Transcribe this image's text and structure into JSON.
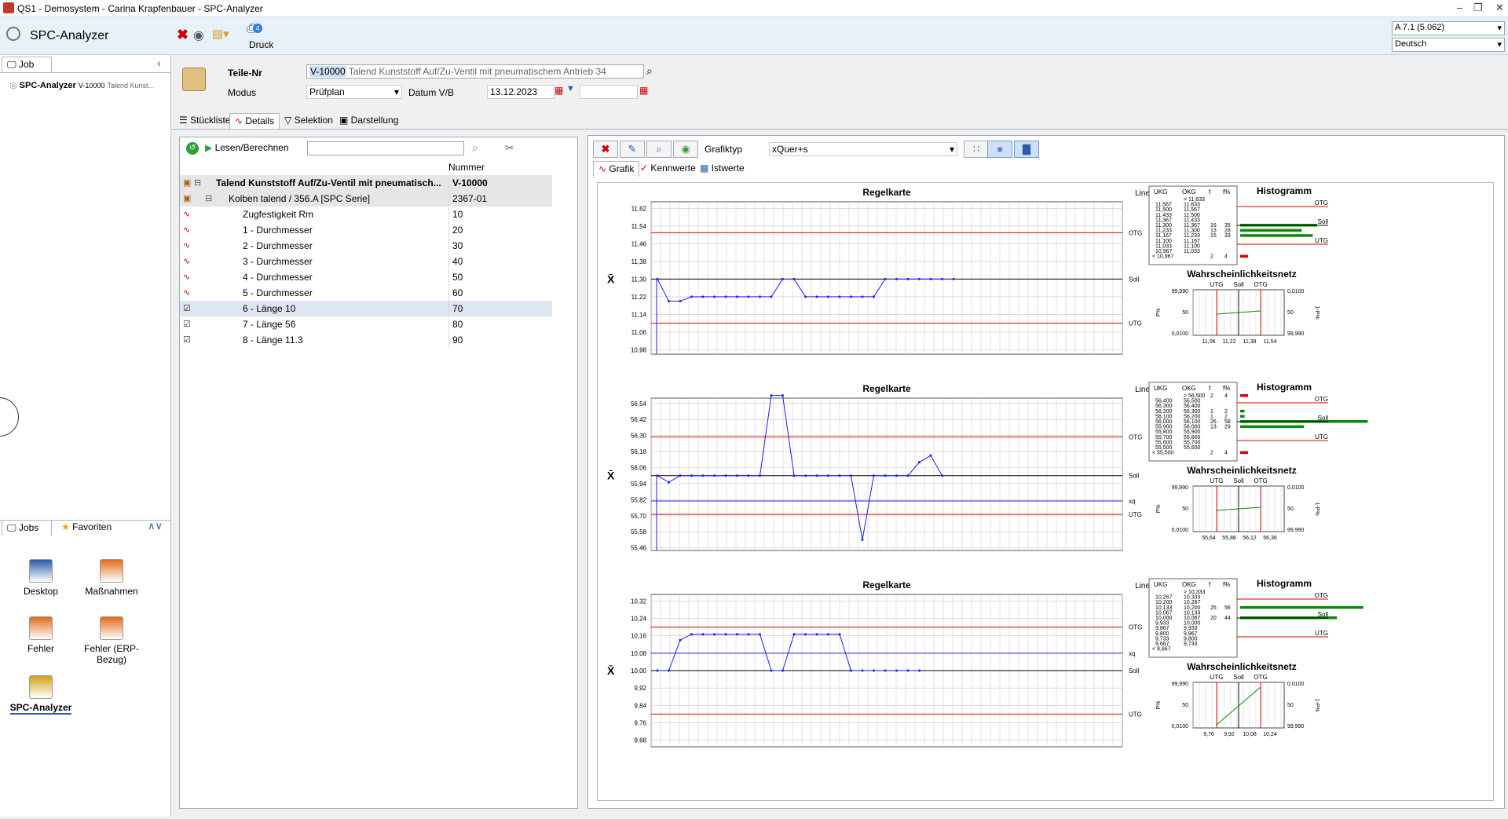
{
  "window": {
    "title": "QS1 - Demosystem - Carina Krapfenbauer - SPC-Analyzer"
  },
  "ribbon": {
    "app": "SPC-Analyzer",
    "print": "Druck",
    "print_badge": "4",
    "version": "A 7.1 (5.062)",
    "language": "Deutsch"
  },
  "left": {
    "job_tab": "Job",
    "job_title": "SPC-Analyzer",
    "job_part": "V-10000",
    "job_desc": "Talend Kunst...",
    "jobs_tab": "Jobs",
    "fav_tab": "Favoriten",
    "apps": [
      {
        "label": "Desktop"
      },
      {
        "label": "Maßnahmen"
      },
      {
        "label": "Fehler"
      },
      {
        "label": "Fehler (ERP-Bezug)"
      },
      {
        "label": "SPC-Analyzer"
      }
    ]
  },
  "form": {
    "part_label": "Teile-Nr",
    "part_id": "V-10000",
    "part_desc": "Talend Kunststoff Auf/Zu-Ventil mit pneumatischem Antrieb  34",
    "mode_label": "Modus",
    "mode_value": "Prüfplan",
    "date_label": "Datum V/B",
    "date_from": "13.12.2023",
    "date_to": ""
  },
  "tabs": {
    "t1": "Stückliste",
    "t2": "Details",
    "t3": "Selektion",
    "t4": "Darstellung"
  },
  "tree": {
    "read_button": "Lesen/Berechnen",
    "col_number": "Nummer",
    "rows": [
      {
        "label": "Talend Kunststoff Auf/Zu-Ventil mit pneumatisch...",
        "number": "V-10000",
        "level": 0,
        "bold": true
      },
      {
        "label": "Kolben talend / 356.A   [SPC Serie]",
        "number": "2367-01",
        "level": 1,
        "bold": false
      },
      {
        "label": "Zugfestigkeit Rm",
        "number": "10",
        "level": 2,
        "bold": false
      },
      {
        "label": "1 - Durchmesser",
        "number": "20",
        "level": 2,
        "bold": false
      },
      {
        "label": "2 - Durchmesser",
        "number": "30",
        "level": 2,
        "bold": false
      },
      {
        "label": "3 - Durchmesser",
        "number": "40",
        "level": 2,
        "bold": false
      },
      {
        "label": "4 - Durchmesser",
        "number": "50",
        "level": 2,
        "bold": false
      },
      {
        "label": "5 - Durchmesser",
        "number": "60",
        "level": 2,
        "bold": false
      },
      {
        "label": "6 - Länge 10",
        "number": "70",
        "level": 2,
        "bold": false
      },
      {
        "label": "7 - Länge 56",
        "number": "80",
        "level": 2,
        "bold": false
      },
      {
        "label": "8 - Länge 11.3",
        "number": "90",
        "level": 2,
        "bold": false
      }
    ]
  },
  "graph": {
    "type_label": "Grafiktyp",
    "type_value": "xQuer+s",
    "tab_grafik": "Grafik",
    "tab_kenn": "Kennwerte",
    "tab_ist": "Istwerte"
  },
  "chart_data": [
    {
      "type": "line",
      "title": "Regelkarte",
      "scale": "Linear",
      "symbol": "X̄",
      "yticks": [
        "11,62",
        "11,54",
        "11,46",
        "11,38",
        "11,30",
        "11,22",
        "11,14",
        "11,06",
        "10,98"
      ],
      "ylim": [
        10.96,
        11.65
      ],
      "lines": [
        {
          "label": "OTG",
          "y": 11.51,
          "color": "#e00000"
        },
        {
          "label": "Soll",
          "y": 11.3,
          "color": "#000000"
        },
        {
          "label": "UTG",
          "y": 11.1,
          "color": "#e00000"
        }
      ],
      "values": [
        11.3,
        11.2,
        11.2,
        11.22,
        11.22,
        11.22,
        11.22,
        11.22,
        11.22,
        11.22,
        11.22,
        11.3,
        11.3,
        11.22,
        11.22,
        11.22,
        11.22,
        11.22,
        11.22,
        11.22,
        11.3,
        11.3,
        11.3,
        11.3,
        11.3,
        11.3,
        11.3
      ],
      "hist": {
        "title": "Histogramm",
        "cols": [
          "UKG",
          "OKG",
          "f",
          "f%"
        ],
        "rows": [
          [
            "",
            "> 11,633",
            "",
            ""
          ],
          [
            "11,567",
            "11,633",
            "",
            ""
          ],
          [
            "11,500",
            "11,567",
            "",
            ""
          ],
          [
            "11,433",
            "11,500",
            "",
            ""
          ],
          [
            "11,367",
            "11,433",
            "",
            ""
          ],
          [
            "11,300",
            "11,367",
            "16",
            "35"
          ],
          [
            "11,233",
            "11,300",
            "13",
            "28"
          ],
          [
            "11,167",
            "11,233",
            "15",
            "33"
          ],
          [
            "11,100",
            "11,167",
            "",
            ""
          ],
          [
            "11,033",
            "11,100",
            "",
            ""
          ],
          [
            "10,967",
            "11,033",
            "",
            ""
          ],
          [
            "< 10,967",
            "",
            "2",
            "4"
          ]
        ],
        "labels": [
          "OTG",
          "Soll",
          "UTG"
        ]
      },
      "prob": {
        "title": "Wahrscheinlichkeitsnetz",
        "top": [
          "UTG",
          "Soll",
          "OTG"
        ],
        "left": [
          "99,990",
          "50",
          "0,0100"
        ],
        "right": [
          "0,0100",
          "50",
          "99,990"
        ],
        "bottom": [
          "11,06",
          "11,22",
          "11,38",
          "11,54"
        ],
        "ylabel_left": "P%",
        "ylabel_right": "1-P%"
      }
    },
    {
      "type": "line",
      "title": "Regelkarte",
      "scale": "Linear",
      "symbol": "X̄",
      "yticks": [
        "56,54",
        "56,42",
        "56,30",
        "56,18",
        "56,06",
        "55,94",
        "55,82",
        "55,70",
        "55,58",
        "55,46"
      ],
      "ylim": [
        55.44,
        56.58
      ],
      "lines": [
        {
          "label": "OTG",
          "y": 56.29,
          "color": "#e00000"
        },
        {
          "label": "Soll",
          "y": 56.0,
          "color": "#000000"
        },
        {
          "label": "xq",
          "y": 55.81,
          "color": "#1a1aff"
        },
        {
          "label": "UTG",
          "y": 55.71,
          "color": "#e00000"
        }
      ],
      "values": [
        56.0,
        55.95,
        56.0,
        56.0,
        56.0,
        56.0,
        56.0,
        56.0,
        56.0,
        56.0,
        56.6,
        56.6,
        56.0,
        56.0,
        56.0,
        56.0,
        56.0,
        56.0,
        55.52,
        56.0,
        56.0,
        56.0,
        56.0,
        56.1,
        56.15,
        56.0
      ],
      "hist": {
        "title": "Histogramm",
        "cols": [
          "UKG",
          "OKG",
          "f",
          "f%"
        ],
        "rows": [
          [
            "",
            "> 56,500",
            "2",
            "4"
          ],
          [
            "56,400",
            "56,500",
            "",
            ""
          ],
          [
            "56,300",
            "56,400",
            "",
            ""
          ],
          [
            "56,200",
            "56,300",
            "1",
            "2"
          ],
          [
            "56,100",
            "56,200",
            "1",
            "2"
          ],
          [
            "56,000",
            "56,100",
            "26",
            "58"
          ],
          [
            "55,900",
            "56,000",
            "13",
            "29"
          ],
          [
            "55,800",
            "55,900",
            "",
            ""
          ],
          [
            "55,700",
            "55,800",
            "",
            ""
          ],
          [
            "55,600",
            "55,700",
            "",
            ""
          ],
          [
            "55,500",
            "55,600",
            "",
            ""
          ],
          [
            "< 55,500",
            "",
            "2",
            "4"
          ]
        ],
        "labels": [
          "OTG",
          "Soll",
          "UTG"
        ]
      },
      "prob": {
        "title": "Wahrscheinlichkeitsnetz",
        "top": [
          "UTG",
          "Soll",
          "OTG"
        ],
        "left": [
          "99,990",
          "50",
          "0,0100"
        ],
        "right": [
          "0,0100",
          "50",
          "99,990"
        ],
        "bottom": [
          "55,64",
          "55,88",
          "56,12",
          "56,36"
        ],
        "ylabel_left": "P%",
        "ylabel_right": "1-P%"
      }
    },
    {
      "type": "line",
      "title": "Regelkarte",
      "scale": "Linear",
      "symbol": "X̄",
      "yticks": [
        "10,32",
        "10,24",
        "10,16",
        "10,08",
        "10,00",
        "9,92",
        "9,84",
        "9,76",
        "9,68"
      ],
      "ylim": [
        9.65,
        10.35
      ],
      "lines": [
        {
          "label": "OTG",
          "y": 10.2,
          "color": "#e00000"
        },
        {
          "label": "xq",
          "y": 10.08,
          "color": "#1a1aff"
        },
        {
          "label": "Soll",
          "y": 10.0,
          "color": "#000000"
        },
        {
          "label": "UTG",
          "y": 9.8,
          "color": "#e00000"
        }
      ],
      "values": [
        10.0,
        10.0,
        10.14,
        10.167,
        10.167,
        10.167,
        10.167,
        10.167,
        10.167,
        10.167,
        10.0,
        10.0,
        10.167,
        10.167,
        10.167,
        10.167,
        10.167,
        10.0,
        10.0,
        10.0,
        10.0,
        10.0,
        10.0,
        10.0
      ],
      "hist": {
        "title": "Histogramm",
        "cols": [
          "UKG",
          "OKG",
          "f",
          "f%"
        ],
        "rows": [
          [
            "",
            "> 10,333",
            "",
            ""
          ],
          [
            "10,267",
            "10,333",
            "",
            ""
          ],
          [
            "10,200",
            "10,267",
            "",
            ""
          ],
          [
            "10,133",
            "10,200",
            "25",
            "56"
          ],
          [
            "10,067",
            "10,133",
            "",
            ""
          ],
          [
            "10,000",
            "10,067",
            "20",
            "44"
          ],
          [
            "9,933",
            "10,000",
            "",
            ""
          ],
          [
            "9,867",
            "9,933",
            "",
            ""
          ],
          [
            "9,800",
            "9,867",
            "",
            ""
          ],
          [
            "9,733",
            "9,800",
            "",
            ""
          ],
          [
            "9,667",
            "9,733",
            "",
            ""
          ],
          [
            "< 9,667",
            "",
            "",
            ""
          ]
        ],
        "labels": [
          "OTG",
          "Soll",
          "UTG"
        ]
      },
      "prob": {
        "title": "Wahrscheinlichkeitsnetz",
        "top": [
          "UTG",
          "Soll",
          "OTG"
        ],
        "left": [
          "99,990",
          "50",
          "0,0100"
        ],
        "right": [
          "0,0100",
          "50",
          "99,990"
        ],
        "bottom": [
          "9,76",
          "9,92",
          "10,08",
          "10,24"
        ],
        "ylabel_left": "P%",
        "ylabel_right": "1-P%"
      }
    }
  ]
}
